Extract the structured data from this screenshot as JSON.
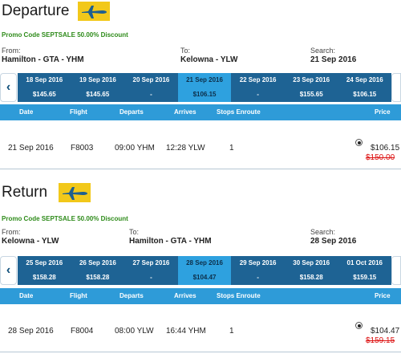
{
  "departure": {
    "title": "Departure",
    "promo": "Promo Code SEPTSALE 50.00% Discount",
    "from_label": "From:",
    "from_value": "Hamilton - GTA - YHM",
    "to_label": "To:",
    "to_value": "Kelowna - YLW",
    "search_label": "Search:",
    "search_value": "21 Sep 2016",
    "dates": [
      {
        "date": "18 Sep 2016",
        "price": "$145.65",
        "selected": false
      },
      {
        "date": "19 Sep 2016",
        "price": "$145.65",
        "selected": false
      },
      {
        "date": "20 Sep 2016",
        "price": "-",
        "selected": false
      },
      {
        "date": "21 Sep 2016",
        "price": "$106.15",
        "selected": true
      },
      {
        "date": "22 Sep 2016",
        "price": "-",
        "selected": false
      },
      {
        "date": "23 Sep 2016",
        "price": "$155.65",
        "selected": false
      },
      {
        "date": "24 Sep 2016",
        "price": "$106.15",
        "selected": false
      }
    ],
    "columns": {
      "date": "Date",
      "flight": "Flight",
      "departs": "Departs",
      "arrives": "Arrives",
      "stops": "Stops Enroute",
      "price": "Price"
    },
    "flight": {
      "date": "21 Sep 2016",
      "number": "F8003",
      "departs": "09:00 YHM",
      "arrives": "12:28 YLW",
      "stops": "1",
      "price": "$106.15",
      "old_price": "$150.00"
    }
  },
  "return": {
    "title": "Return",
    "promo": "Promo Code SEPTSALE 50.00% Discount",
    "from_label": "From:",
    "from_value": "Kelowna - YLW",
    "to_label": "To:",
    "to_value": "Hamilton - GTA - YHM",
    "search_label": "Search:",
    "search_value": "28 Sep 2016",
    "dates": [
      {
        "date": "25 Sep 2016",
        "price": "$158.28",
        "selected": false
      },
      {
        "date": "26 Sep 2016",
        "price": "$158.28",
        "selected": false
      },
      {
        "date": "27 Sep 2016",
        "price": "-",
        "selected": false
      },
      {
        "date": "28 Sep 2016",
        "price": "$104.47",
        "selected": true
      },
      {
        "date": "29 Sep 2016",
        "price": "-",
        "selected": false
      },
      {
        "date": "30 Sep 2016",
        "price": "$158.28",
        "selected": false
      },
      {
        "date": "01 Oct 2016",
        "price": "$159.15",
        "selected": false
      }
    ],
    "columns": {
      "date": "Date",
      "flight": "Flight",
      "departs": "Departs",
      "arrives": "Arrives",
      "stops": "Stops Enroute",
      "price": "Price"
    },
    "flight": {
      "date": "28 Sep 2016",
      "number": "F8004",
      "departs": "08:00 YLW",
      "arrives": "16:44 YHM",
      "stops": "1",
      "price": "$104.47",
      "old_price": "$159.15"
    }
  },
  "icons": {
    "plane": "airplane-icon",
    "prev": "chevron-left-icon",
    "next": "chevron-right-icon"
  },
  "colors": {
    "strip": "#1e6394",
    "selected_date": "#2ea1df",
    "column_header": "#2e9bd8",
    "promo": "#2e8b1a",
    "old_price": "#dd1111",
    "plane_bg": "#f2c81a"
  }
}
